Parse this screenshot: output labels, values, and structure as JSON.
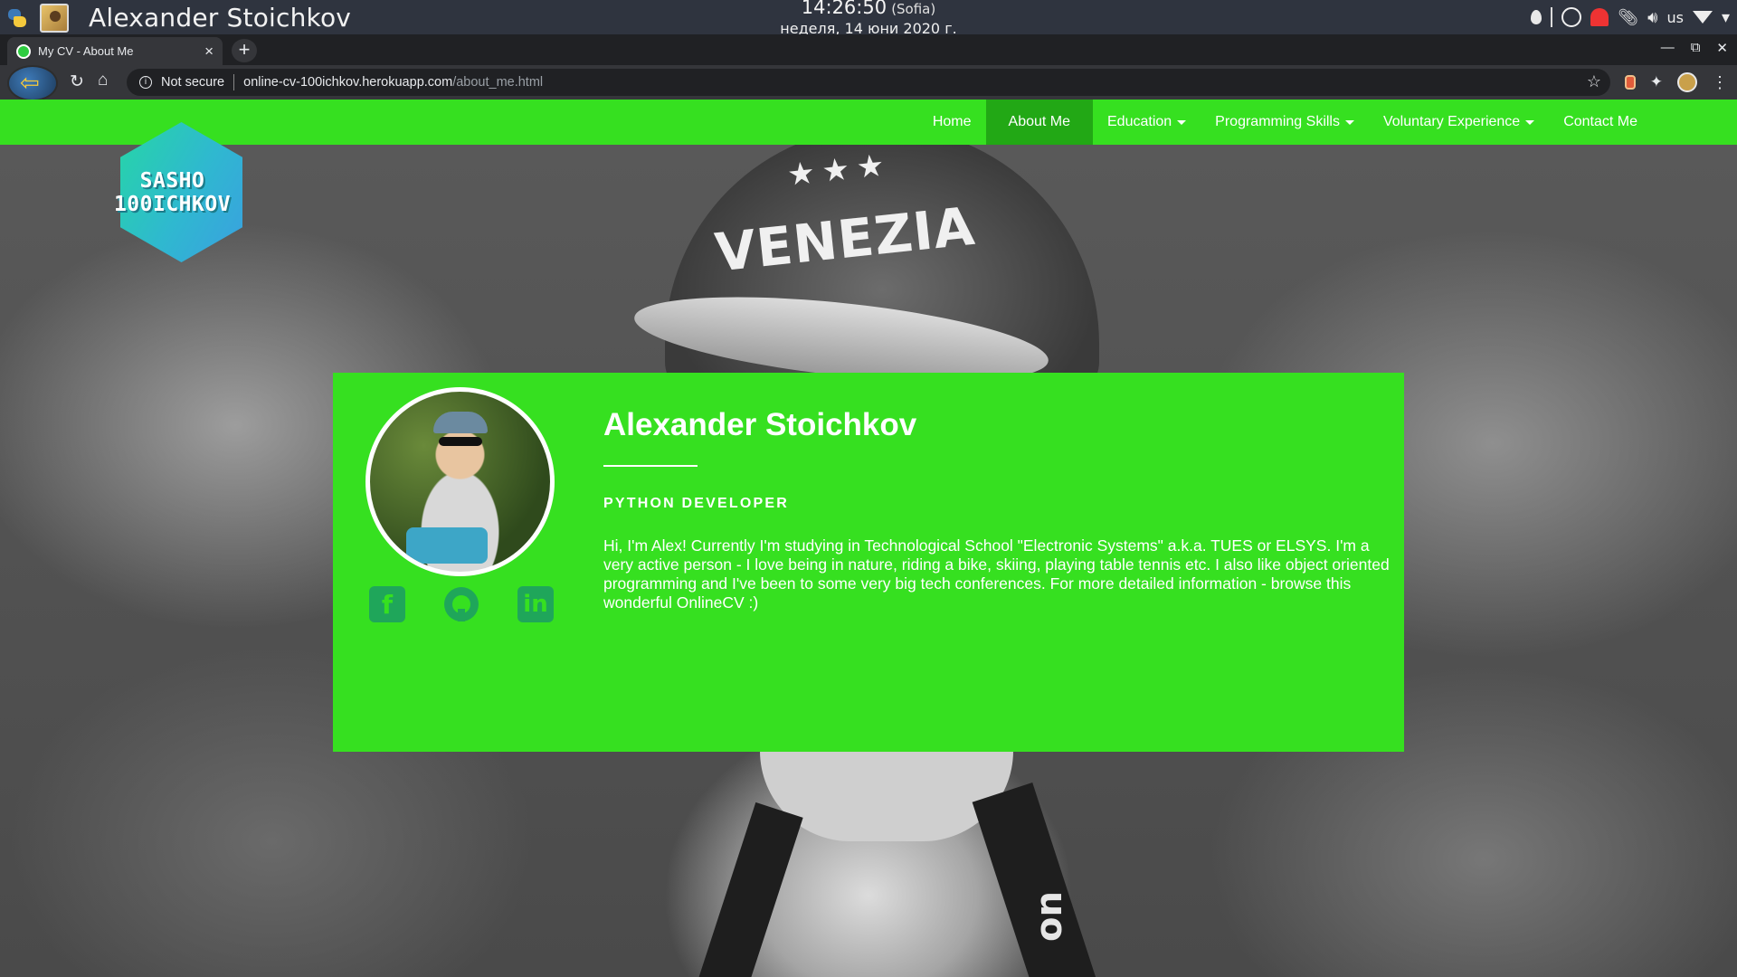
{
  "os": {
    "window_title": "Alexander Stoichkov",
    "clock_time": "14:26:50",
    "clock_tz": "(Sofia)",
    "clock_date": "неделя, 14 юни 2020 г.",
    "keyboard_layout": "us"
  },
  "browser": {
    "tab_title": "My CV - About Me",
    "security_label": "Not secure",
    "url_host": "online-cv-100ichkov.herokuapp.com",
    "url_path": "/about_me.html"
  },
  "site": {
    "logo_line1": "SASHO",
    "logo_line2": "100ICHKOV",
    "nav": {
      "home": "Home",
      "about": "About Me",
      "education": "Education",
      "programming": "Programming Skills",
      "voluntary": "Voluntary Experience",
      "contact": "Contact Me"
    },
    "active_nav": "about",
    "accent_color": "#36e020",
    "active_nav_color": "#22a815",
    "background_cap_text": "VENEZIA",
    "background_strap_text": "on"
  },
  "profile": {
    "name": "Alexander Stoichkov",
    "role": "PYTHON DEVELOPER",
    "bio": "Hi, I'm Alex! Currently I'm studying in Technological School \"Electronic Systems\" a.k.a. TUES or ELSYS. I'm a very active person - I love being in nature, riding a bike, skiing, playing table tennis etc. I also like object oriented programming and I've been to some very big tech conferences. For more detailed information - browse this wonderful OnlineCV :)",
    "socials": {
      "facebook_glyph": "f",
      "linkedin_glyph": "in"
    }
  }
}
